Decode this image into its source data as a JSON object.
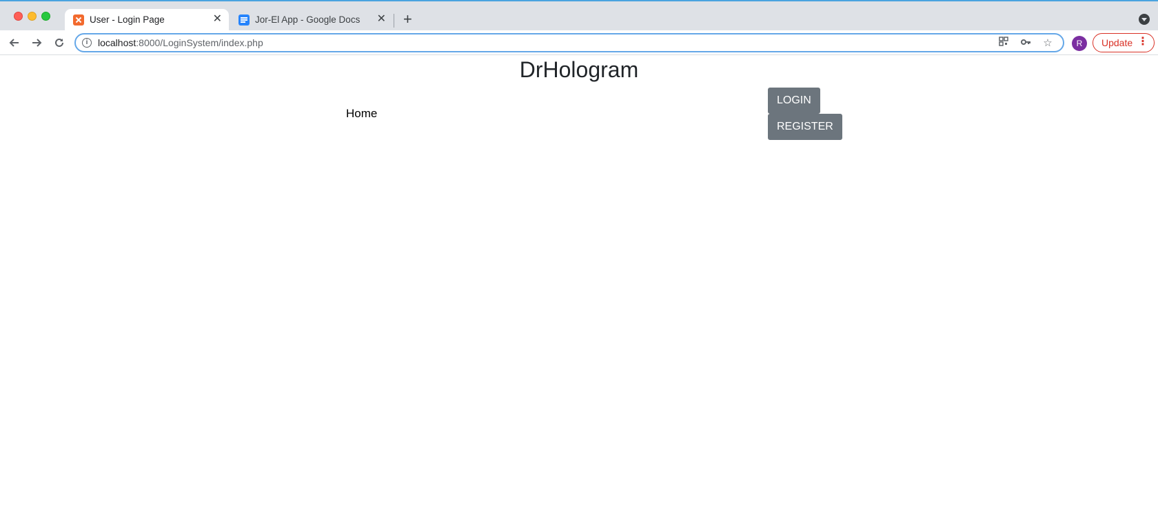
{
  "browser": {
    "tabs": [
      {
        "title": "User - Login Page",
        "favicon": "xampp-icon",
        "active": true
      },
      {
        "title": "Jor-El App - Google Docs",
        "favicon": "google-docs-icon",
        "active": false
      }
    ],
    "new_tab_symbol": "+",
    "close_symbol": "✕",
    "url_host": "localhost",
    "url_rest": ":8000/LoginSystem/index.php",
    "profile_initial": "R",
    "update_label": "Update",
    "accent_colors": {
      "update": "#d93025",
      "focus": "#64a7e8",
      "avatar": "#7b2fa1"
    }
  },
  "page": {
    "title": "DrHologram",
    "nav": {
      "home_label": "Home"
    },
    "buttons": {
      "login_label": "LOGIN",
      "register_label": "REGISTER"
    },
    "button_color": "#6c757d"
  }
}
